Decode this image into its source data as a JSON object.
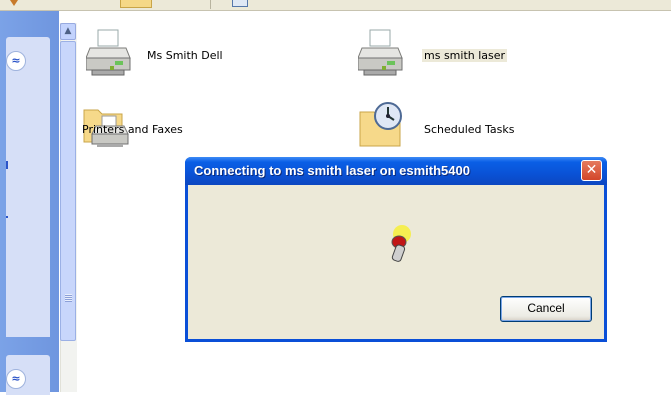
{
  "window": {
    "items": [
      {
        "label": "Ms Smith Dell",
        "icon": "printer-icon"
      },
      {
        "label": "ms smith laser",
        "icon": "printer-icon",
        "selected": true
      },
      {
        "label": "Printers and Faxes",
        "icon": "printers-folder-icon"
      },
      {
        "label": "Scheduled Tasks",
        "icon": "scheduled-tasks-folder-icon"
      }
    ]
  },
  "taskpane": {
    "collapse_glyph": "≈",
    "colors": {
      "pane": "#6f96df",
      "panel": "#d6dff7"
    }
  },
  "dialog": {
    "title": "Connecting to ms smith laser on esmith5400",
    "close_glyph": "✕",
    "cancel_label": "Cancel",
    "colors": {
      "titlebar": "#0a52d6",
      "body": "#ece9d8",
      "close": "#d3462a"
    }
  },
  "scrollbar": {
    "up_glyph": "▲"
  }
}
